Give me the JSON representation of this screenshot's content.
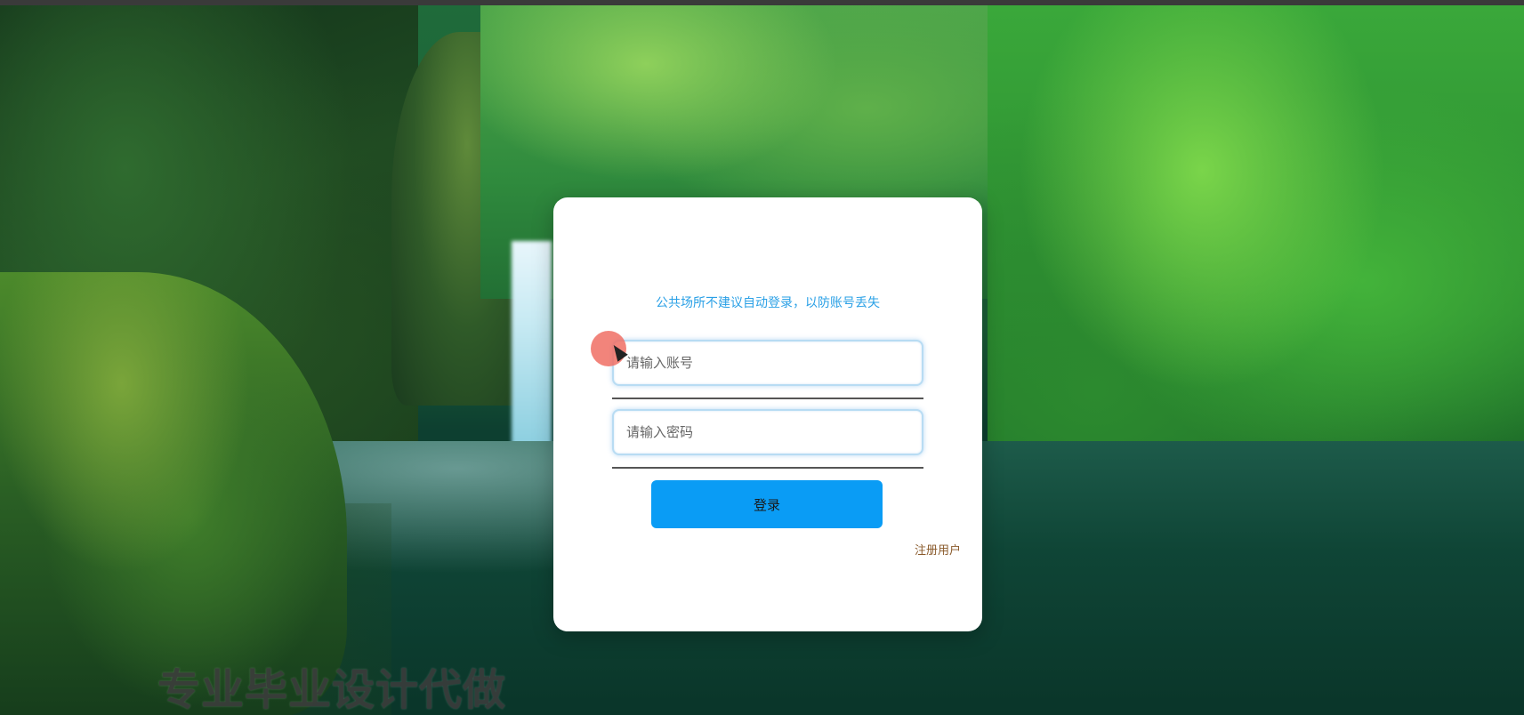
{
  "login": {
    "notice": "公共场所不建议自动登录，以防账号丢失",
    "account_placeholder": "请输入账号",
    "password_placeholder": "请输入密码",
    "login_button": "登录",
    "register_link": "注册用户"
  },
  "watermark": "专业毕业设计代做",
  "colors": {
    "accent": "#0a9cf5",
    "notice_text": "#2aa0e6",
    "register_text": "#8a5a2b",
    "card_background": "#ffffff"
  }
}
